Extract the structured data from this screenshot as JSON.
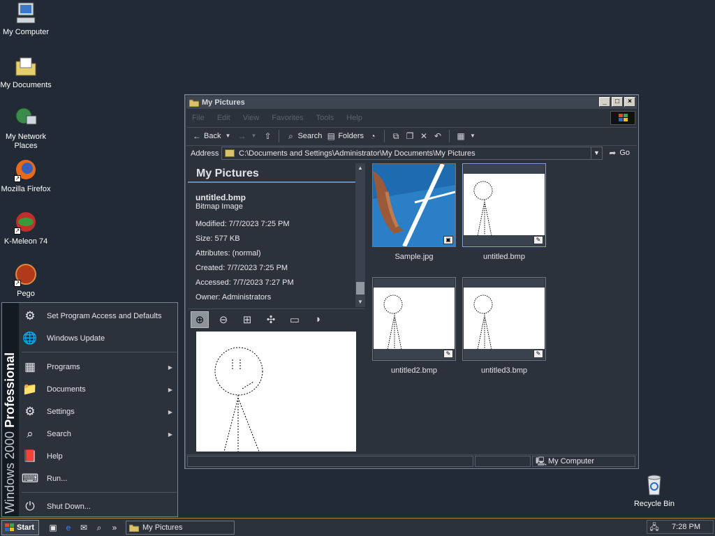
{
  "desktop": {
    "icons": [
      {
        "label": "My Computer"
      },
      {
        "label": "My Documents"
      },
      {
        "label": "My Network Places"
      },
      {
        "label": "Mozilla Firefox"
      },
      {
        "label": "K-Meleon 74"
      },
      {
        "label": "Pego"
      },
      {
        "label": "Recycle Bin"
      }
    ]
  },
  "window": {
    "title": "My Pictures",
    "menu": [
      "File",
      "Edit",
      "View",
      "Favorites",
      "Tools",
      "Help"
    ],
    "toolbar": {
      "back": "Back",
      "search": "Search",
      "folders": "Folders"
    },
    "address": {
      "label": "Address",
      "path": "C:\\Documents and Settings\\Administrator\\My Documents\\My Pictures",
      "go": "Go"
    },
    "info": {
      "heading": "My Pictures",
      "filename": "untitled.bmp",
      "filetype": "Bitmap Image",
      "modified": "Modified: 7/7/2023 7:25 PM",
      "size": "Size: 577 KB",
      "attributes": "Attributes: (normal)",
      "created": "Created: 7/7/2023 7:25 PM",
      "accessed": "Accessed: 7/7/2023 7:27 PM",
      "owner": "Owner: Administrators"
    },
    "files": [
      {
        "name": "Sample.jpg"
      },
      {
        "name": "untitled.bmp"
      },
      {
        "name": "untitled2.bmp"
      },
      {
        "name": "untitled3.bmp"
      }
    ],
    "status": {
      "zone": "My Computer"
    }
  },
  "startmenu": {
    "band_brand": "Windows 2000",
    "band_edition": " Professional",
    "items": [
      {
        "label": "Set Program Access and Defaults"
      },
      {
        "label": "Windows Update"
      },
      {
        "label": "Programs"
      },
      {
        "label": "Documents"
      },
      {
        "label": "Settings"
      },
      {
        "label": "Search"
      },
      {
        "label": "Help"
      },
      {
        "label": "Run..."
      },
      {
        "label": "Shut Down..."
      }
    ]
  },
  "taskbar": {
    "start": "Start",
    "task": "My Pictures",
    "time": "7:28 PM"
  },
  "colors": {
    "desktop": "#222a35",
    "window": "#2b323c",
    "accent": "#6a8cb8"
  }
}
